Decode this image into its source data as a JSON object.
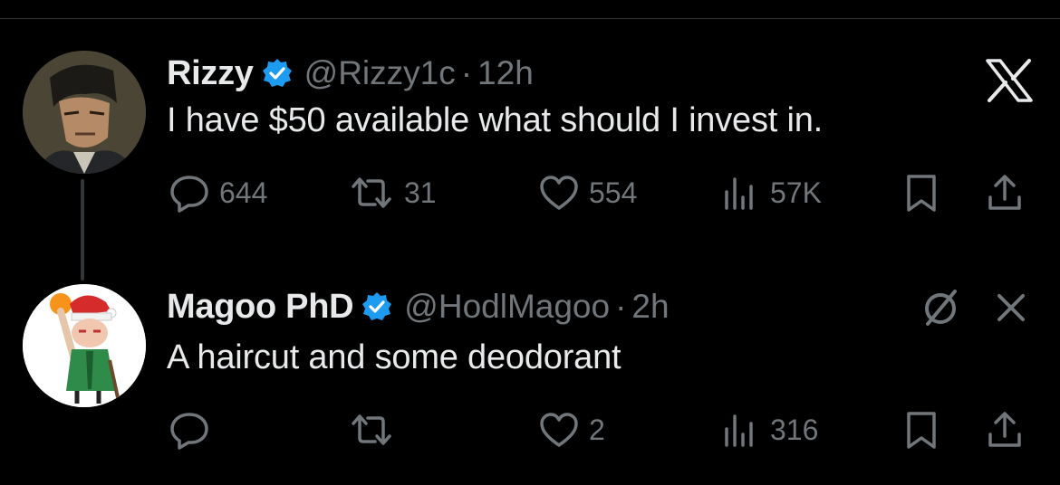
{
  "tweets": [
    {
      "name": "Rizzy",
      "handle": "@Rizzy1c",
      "separator": "·",
      "time": "12h",
      "text": "I have $50 available what should I invest in.",
      "replies": "644",
      "reposts": "31",
      "likes": "554",
      "views": "57K"
    },
    {
      "name": "Magoo PhD",
      "handle": "@HodlMagoo",
      "separator": "·",
      "time": "2h",
      "text": "A haircut and some deodorant",
      "replies": "",
      "reposts": "",
      "likes": "2",
      "views": "316"
    }
  ],
  "icons": {
    "verified": "verified-badge-icon",
    "reply": "reply-icon",
    "repost": "repost-icon",
    "like": "heart-icon",
    "views": "views-icon",
    "bookmark": "bookmark-icon",
    "share": "share-icon",
    "brand": "x-logo-icon",
    "hide": "slash-circle-icon",
    "close": "close-icon"
  },
  "colors": {
    "background": "#000000",
    "text": "#e7e9ea",
    "muted": "#71767b",
    "verified": "#1d9bf0"
  }
}
